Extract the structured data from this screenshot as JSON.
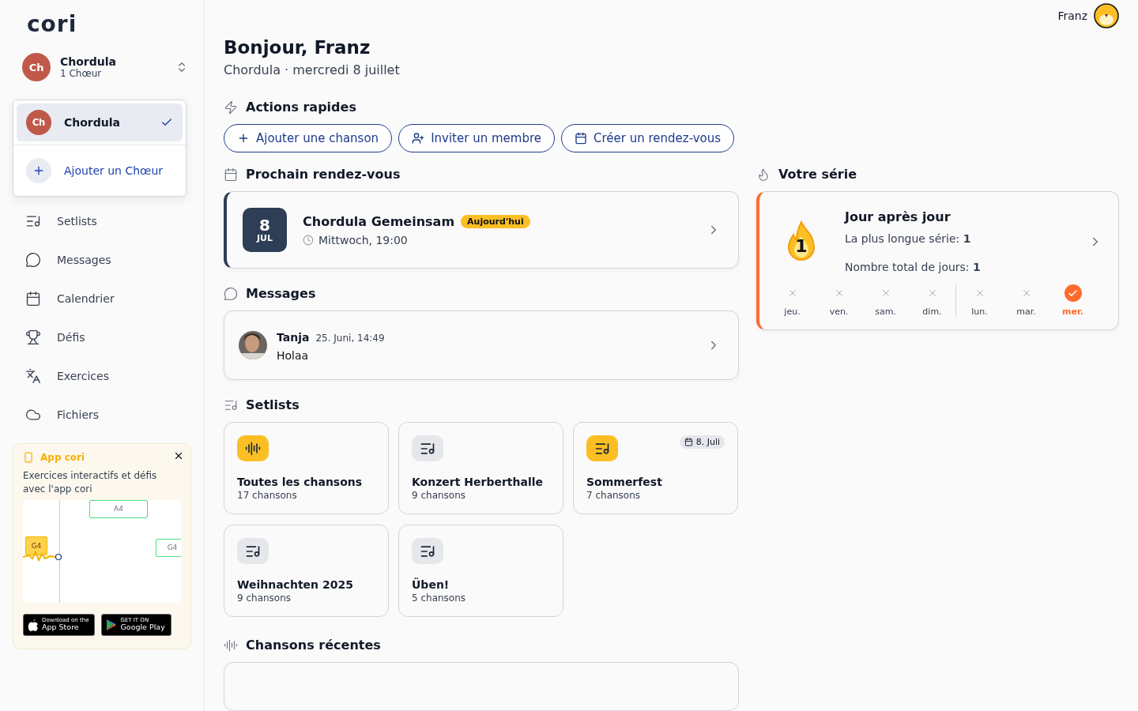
{
  "logo": "cori",
  "choir_switcher": {
    "initials": "Ch",
    "name": "Chordula",
    "subtitle": "1 Chœur"
  },
  "choir_menu": {
    "items": [
      {
        "initials": "Ch",
        "name": "Chordula",
        "selected": true
      }
    ],
    "add_label": "Ajouter un Chœur"
  },
  "nav": [
    {
      "label": "Setlists"
    },
    {
      "label": "Messages"
    },
    {
      "label": "Calendrier"
    },
    {
      "label": "Défis"
    },
    {
      "label": "Exercices"
    },
    {
      "label": "Fichiers"
    }
  ],
  "promo": {
    "title": "App cori",
    "text": "Exercices interactifs et défis avec l'app cori",
    "notes": [
      "A4",
      "G4",
      "G4"
    ],
    "stores": [
      {
        "kind": "apple",
        "small": "Download on the",
        "big": "App Store"
      },
      {
        "kind": "google",
        "small": "GET IT ON",
        "big": "Google Play"
      }
    ]
  },
  "user": {
    "name": "Franz"
  },
  "greeting": "Bonjour, Franz",
  "subtitle": "Chordula · mercredi 8 juillet",
  "quick_actions": {
    "title": "Actions rapides",
    "buttons": [
      {
        "label": "Ajouter une chanson"
      },
      {
        "label": "Inviter un membre"
      },
      {
        "label": "Créer un rendez-vous"
      }
    ]
  },
  "next_event": {
    "title": "Prochain rendez-vous",
    "day": "8",
    "month": "JUL",
    "name": "Chordula Gemeinsam",
    "badge": "Aujourd'hui",
    "time": "Mittwoch, 19:00"
  },
  "messages": {
    "title": "Messages",
    "items": [
      {
        "author": "Tanja",
        "time": "25. Juni, 14:49",
        "text": "Holaa"
      }
    ]
  },
  "setlists": {
    "title": "Setlists",
    "items": [
      {
        "name": "Toutes les chansons",
        "count": "17 chansons",
        "kind": "all",
        "highlighted": true
      },
      {
        "name": "Konzert Herberthalle",
        "count": "9 chansons",
        "kind": "setlist",
        "highlighted": false
      },
      {
        "name": "Sommerfest",
        "count": "7 chansons",
        "kind": "setlist",
        "highlighted": true,
        "date": "8. Juli"
      },
      {
        "name": "Weihnachten 2025",
        "count": "9 chansons",
        "kind": "setlist",
        "highlighted": false
      },
      {
        "name": "Üben!",
        "count": "5 chansons",
        "kind": "setlist",
        "highlighted": false
      }
    ]
  },
  "recent": {
    "title": "Chansons récentes"
  },
  "streak": {
    "title": "Votre série",
    "heading": "Jour après jour",
    "longest": "La plus longue série: **1**",
    "total": "Nombre total de jours: **1**",
    "flame_number": "1",
    "days": [
      {
        "label": "jeu.",
        "done": false,
        "new_week": false
      },
      {
        "label": "ven.",
        "done": false,
        "new_week": false
      },
      {
        "label": "sam.",
        "done": false,
        "new_week": false
      },
      {
        "label": "dim.",
        "done": false,
        "new_week": false
      },
      {
        "label": "lun.",
        "done": false,
        "new_week": true
      },
      {
        "label": "mar.",
        "done": false,
        "new_week": false
      },
      {
        "label": "mer.",
        "done": true,
        "new_week": false
      }
    ]
  }
}
